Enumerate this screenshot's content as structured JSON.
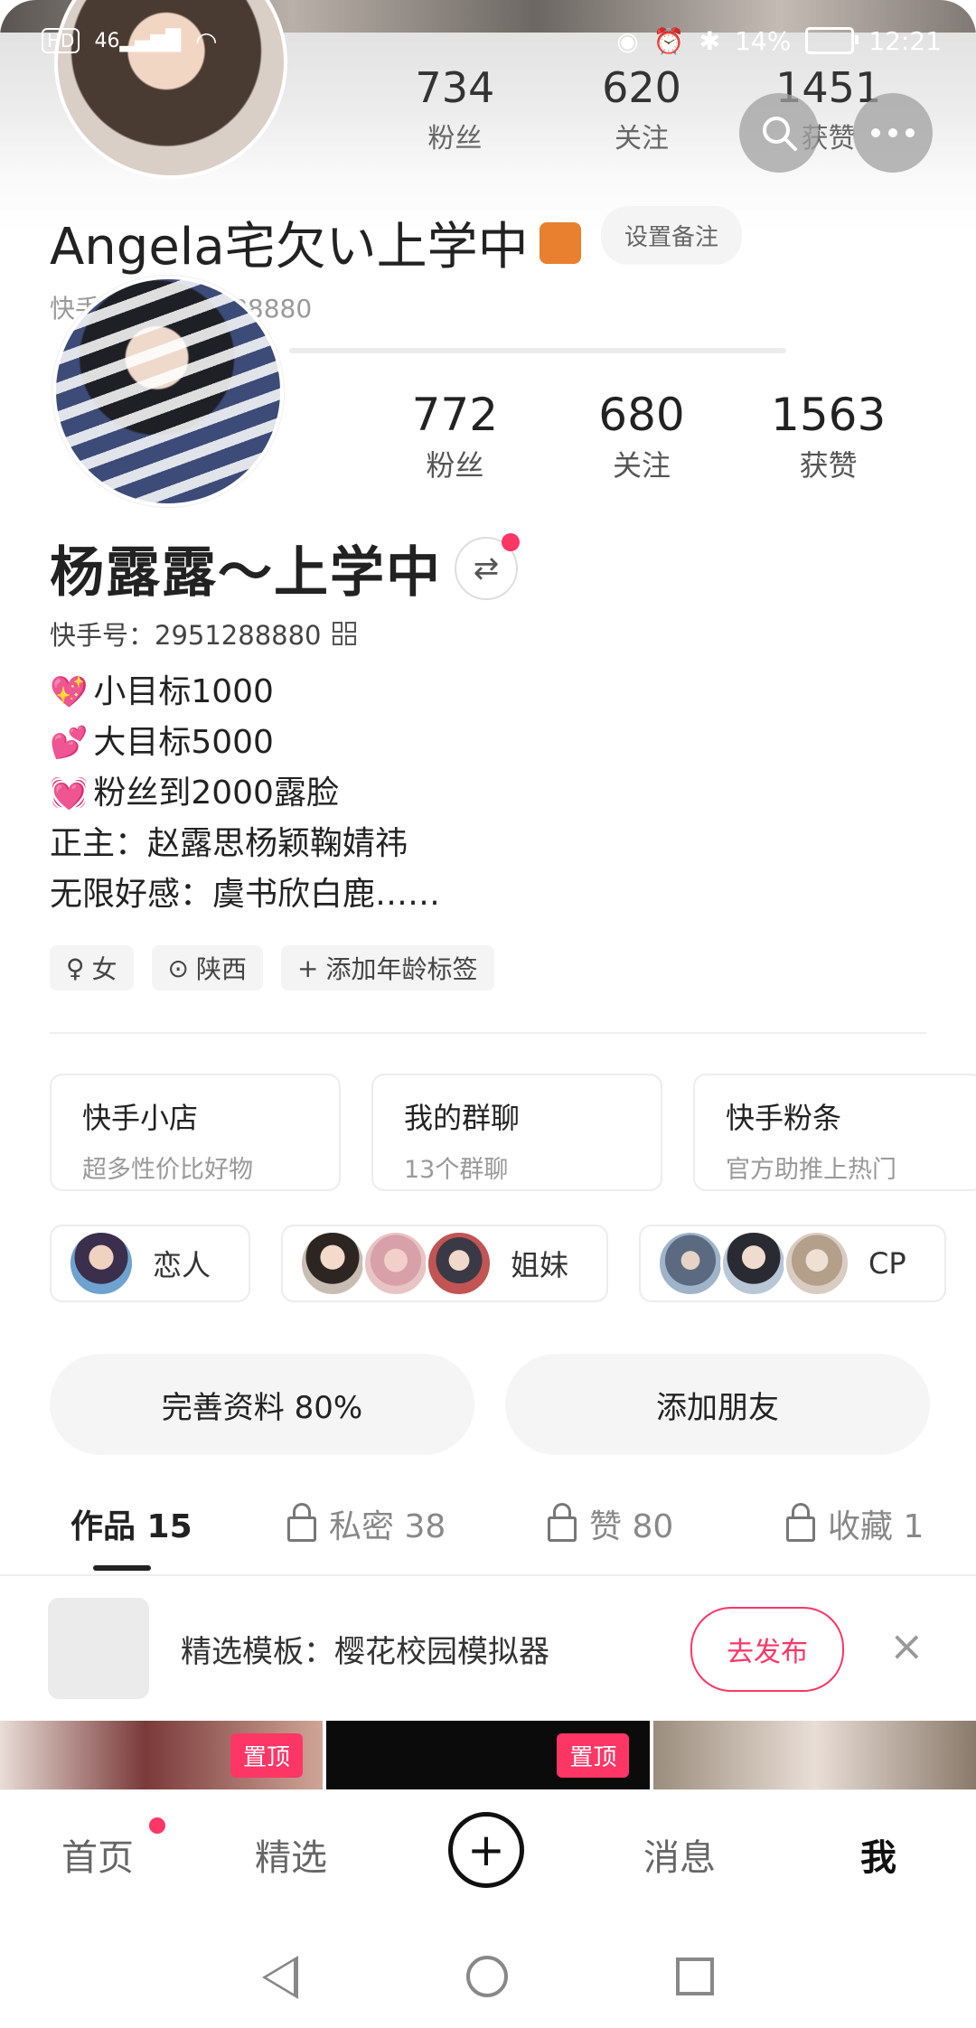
{
  "status_bar": {
    "network_badge": "HD",
    "signal_label": "46",
    "battery_percent": "14%",
    "time": "12:21"
  },
  "switch_preview": {
    "stats": [
      {
        "value": "734",
        "label": "粉丝"
      },
      {
        "value": "620",
        "label": "关注"
      },
      {
        "value": "1451",
        "label": "获赞"
      }
    ],
    "name": "Angela宅欠い上学中",
    "remark_button": "设置备注",
    "kuaishou_id": "快手号：2951288880"
  },
  "profile": {
    "stats": [
      {
        "value": "772",
        "label": "粉丝"
      },
      {
        "value": "680",
        "label": "关注"
      },
      {
        "value": "1563",
        "label": "获赞"
      }
    ],
    "name": "杨露露～上学中",
    "switch_icon": "⇄",
    "kuaishou_id": "快手号：2951288880",
    "bio": [
      {
        "icon": "💖",
        "text": "小目标1000"
      },
      {
        "icon": "💕",
        "text": "大目标5000"
      },
      {
        "icon": "💓",
        "text": "粉丝到2000露脸"
      },
      {
        "icon": "",
        "text": "正主：赵露思杨颖鞠婧祎"
      },
      {
        "icon": "",
        "text": "无限好感：虞书欣白鹿……"
      }
    ],
    "tags": [
      {
        "icon": "♀",
        "text": "女"
      },
      {
        "icon": "⊙",
        "text": "陕西"
      },
      {
        "icon": "+",
        "text": "添加年龄标签"
      }
    ]
  },
  "cards": [
    {
      "title": "快手小店",
      "subtitle": "超多性价比好物"
    },
    {
      "title": "我的群聊",
      "subtitle": "13个群聊"
    },
    {
      "title": "快手粉条",
      "subtitle": "官方助推上热门"
    }
  ],
  "groups": [
    {
      "label": "恋人",
      "avatars": 1
    },
    {
      "label": "姐妹",
      "avatars": 3
    },
    {
      "label": "CP",
      "avatars": 3
    }
  ],
  "actions": {
    "complete_profile": "完善资料 80%",
    "add_friend": "添加朋友"
  },
  "tabs": [
    {
      "label": "作品 15",
      "locked": false
    },
    {
      "label": "私密 38",
      "locked": true
    },
    {
      "label": "赞 80",
      "locked": true
    },
    {
      "label": "收藏 1",
      "locked": true
    }
  ],
  "promo": {
    "text": "精选模板：樱花校园模拟器",
    "button": "去发布",
    "close": "×"
  },
  "grid": {
    "pinned_label": "置顶"
  },
  "bottom_nav": {
    "home": "首页",
    "featured": "精选",
    "publish": "+",
    "messages": "消息",
    "me": "我"
  },
  "colors": {
    "accent": "#fe3666"
  }
}
